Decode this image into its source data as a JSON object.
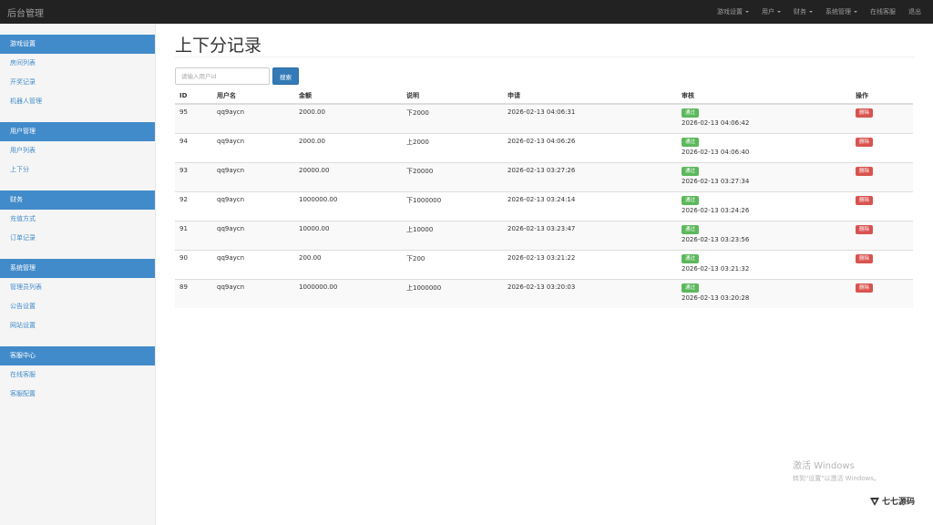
{
  "navbar": {
    "brand": "后台管理",
    "items": [
      {
        "label": "游戏设置",
        "dropdown": true
      },
      {
        "label": "用户",
        "dropdown": true
      },
      {
        "label": "财务",
        "dropdown": true
      },
      {
        "label": "系统管理",
        "dropdown": true
      },
      {
        "label": "在线客服",
        "dropdown": false
      },
      {
        "label": "退出",
        "dropdown": false
      }
    ]
  },
  "sidebar": {
    "groups": [
      {
        "header": "游戏设置",
        "links": [
          "房间列表",
          "开奖记录",
          "机器人管理"
        ]
      },
      {
        "header": "用户管理",
        "links": [
          "用户列表",
          "上下分"
        ]
      },
      {
        "header": "财务",
        "links": [
          "充值方式",
          "订单记录"
        ]
      },
      {
        "header": "系统管理",
        "links": [
          "管理员列表",
          "公告设置",
          "网站设置"
        ]
      },
      {
        "header": "客服中心",
        "links": [
          "在线客服",
          "客服配置"
        ]
      }
    ]
  },
  "main": {
    "title": "上下分记录",
    "search": {
      "placeholder": "请输入用户id",
      "button": "搜索"
    },
    "table": {
      "headers": [
        "ID",
        "用户名",
        "金额",
        "说明",
        "申请",
        "审核",
        "操作"
      ],
      "rows": [
        {
          "id": "95",
          "user": "qq9aycn",
          "amount": "2000.00",
          "desc": "下2000",
          "request": "2026-02-13 04:06:31",
          "status": "通过",
          "audit": "2026-02-13 04:06:42",
          "op": "删除"
        },
        {
          "id": "94",
          "user": "qq9aycn",
          "amount": "2000.00",
          "desc": "上2000",
          "request": "2026-02-13 04:06:26",
          "status": "通过",
          "audit": "2026-02-13 04:06:40",
          "op": "删除"
        },
        {
          "id": "93",
          "user": "qq9aycn",
          "amount": "20000.00",
          "desc": "下20000",
          "request": "2026-02-13 03:27:26",
          "status": "通过",
          "audit": "2026-02-13 03:27:34",
          "op": "删除"
        },
        {
          "id": "92",
          "user": "qq9aycn",
          "amount": "1000000.00",
          "desc": "下1000000",
          "request": "2026-02-13 03:24:14",
          "status": "通过",
          "audit": "2026-02-13 03:24:26",
          "op": "删除"
        },
        {
          "id": "91",
          "user": "qq9aycn",
          "amount": "10000.00",
          "desc": "上10000",
          "request": "2026-02-13 03:23:47",
          "status": "通过",
          "audit": "2026-02-13 03:23:56",
          "op": "删除"
        },
        {
          "id": "90",
          "user": "qq9aycn",
          "amount": "200.00",
          "desc": "下200",
          "request": "2026-02-13 03:21:22",
          "status": "通过",
          "audit": "2026-02-13 03:21:32",
          "op": "删除"
        },
        {
          "id": "89",
          "user": "qq9aycn",
          "amount": "1000000.00",
          "desc": "上1000000",
          "request": "2026-02-13 03:20:03",
          "status": "通过",
          "audit": "2026-02-13 03:20:28",
          "op": "删除"
        }
      ]
    }
  },
  "watermark": {
    "windows_line1": "激活 Windows",
    "windows_line2": "转到\"设置\"以激活 Windows。",
    "logo_text": "七七源码"
  },
  "colors": {
    "navbar_bg": "#222222",
    "sidebar_header": "#428bca",
    "link": "#428bca",
    "primary_button": "#337ab7",
    "success_badge": "#5cb85c",
    "danger_button": "#d9534f"
  }
}
